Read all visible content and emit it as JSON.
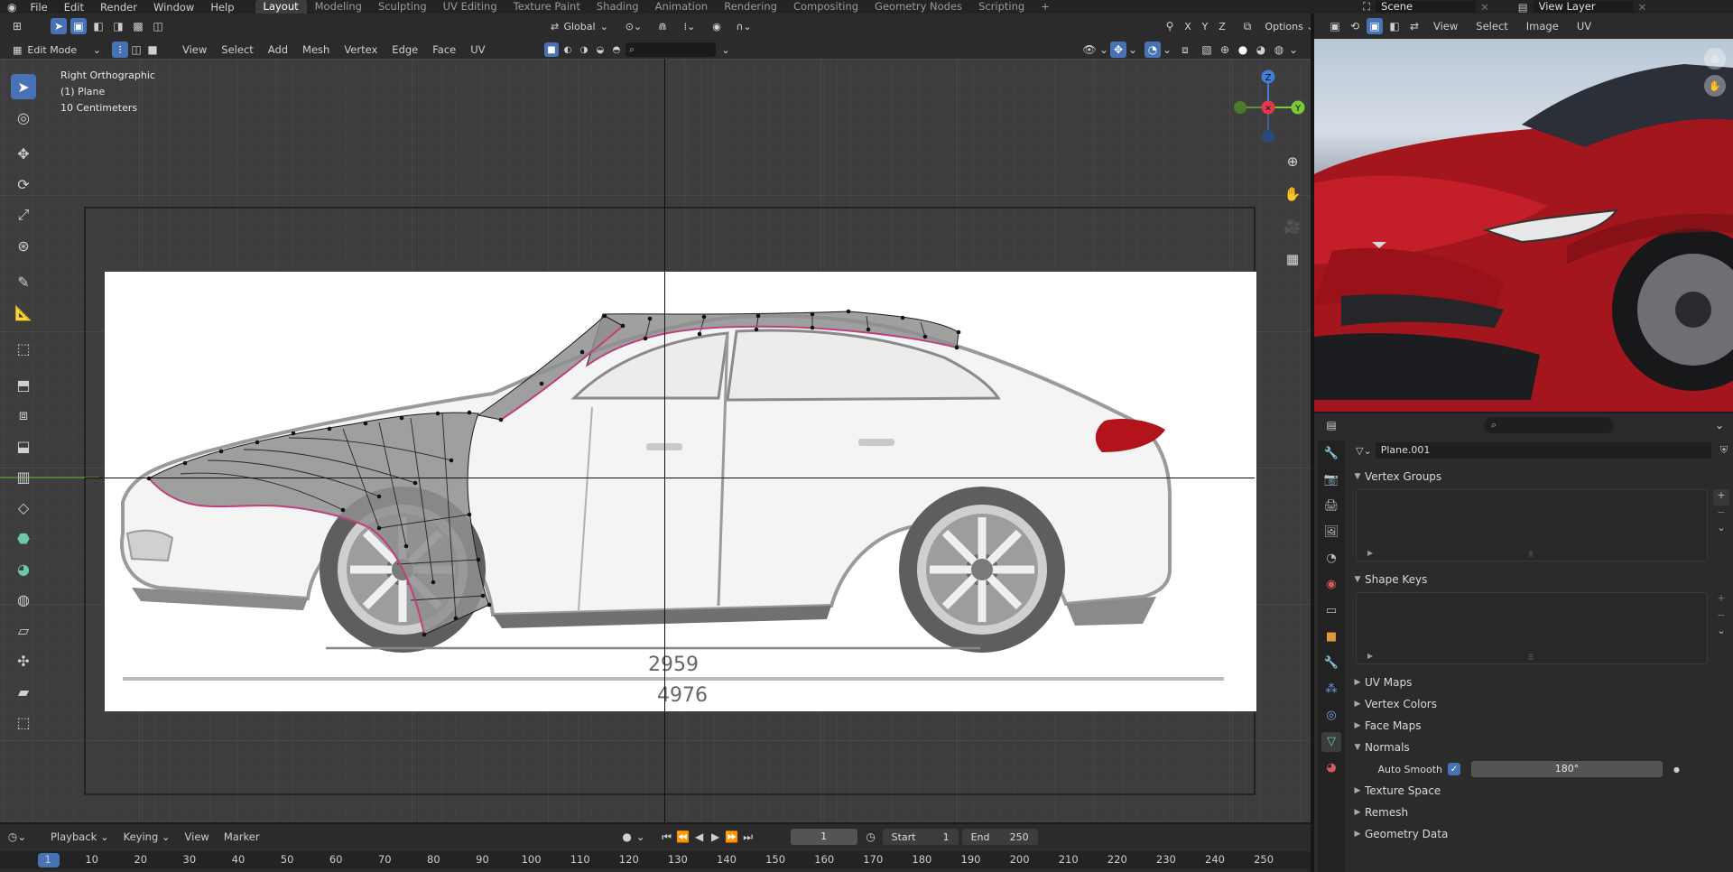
{
  "topbar": {
    "menus": [
      "File",
      "Edit",
      "Render",
      "Window",
      "Help"
    ],
    "workspaces": [
      "Layout",
      "Modeling",
      "Sculpting",
      "UV Editing",
      "Texture Paint",
      "Shading",
      "Animation",
      "Rendering",
      "Compositing",
      "Geometry Nodes",
      "Scripting"
    ],
    "active_workspace": "Layout",
    "add_tab": "+",
    "scene": "Scene",
    "view_layer": "View Layer"
  },
  "viewport_header": {
    "mode": "Edit Mode",
    "menus": [
      "View",
      "Select",
      "Add",
      "Mesh",
      "Vertex",
      "Edge",
      "Face",
      "UV"
    ],
    "orientation": "Global",
    "axes": [
      "X",
      "Y",
      "Z"
    ],
    "options": "Options"
  },
  "viewport": {
    "view_name": "Right Orthographic",
    "object_name": "(1) Plane",
    "scale": "10 Centimeters",
    "gizmo": {
      "z": "Z",
      "y": "Y"
    },
    "reference_dims": {
      "wheelbase": "2959",
      "length": "4976"
    }
  },
  "image_editor": {
    "menus": [
      "View",
      "Select",
      "Image",
      "UV"
    ]
  },
  "properties": {
    "object_data": "Plane.001",
    "panels": [
      {
        "label": "Vertex Groups",
        "open": true
      },
      {
        "label": "Shape Keys",
        "open": true
      },
      {
        "label": "UV Maps",
        "open": false
      },
      {
        "label": "Vertex Colors",
        "open": false
      },
      {
        "label": "Face Maps",
        "open": false
      },
      {
        "label": "Normals",
        "open": true
      },
      {
        "label": "Texture Space",
        "open": false
      },
      {
        "label": "Remesh",
        "open": false
      },
      {
        "label": "Geometry Data",
        "open": false
      }
    ],
    "auto_smooth_label": "Auto Smooth",
    "auto_smooth_checked": true,
    "auto_smooth_angle": "180°"
  },
  "timeline": {
    "menus": [
      "Playback",
      "Keying",
      "View",
      "Marker"
    ],
    "current_frame": "1",
    "start_label": "Start",
    "start": "1",
    "end_label": "End",
    "end": "250",
    "ruler": [
      "1",
      "10",
      "20",
      "30",
      "40",
      "50",
      "60",
      "70",
      "80",
      "90",
      "100",
      "110",
      "120",
      "130",
      "140",
      "150",
      "160",
      "170",
      "180",
      "190",
      "200",
      "210",
      "220",
      "230",
      "240",
      "250"
    ]
  },
  "colors": {
    "accent": "#4772b3",
    "car_red": "#b3141c",
    "mesh_pink": "#c0407e",
    "axis_x": "#e0394c",
    "axis_y": "#7cc93a",
    "axis_z": "#3f7fd6"
  }
}
